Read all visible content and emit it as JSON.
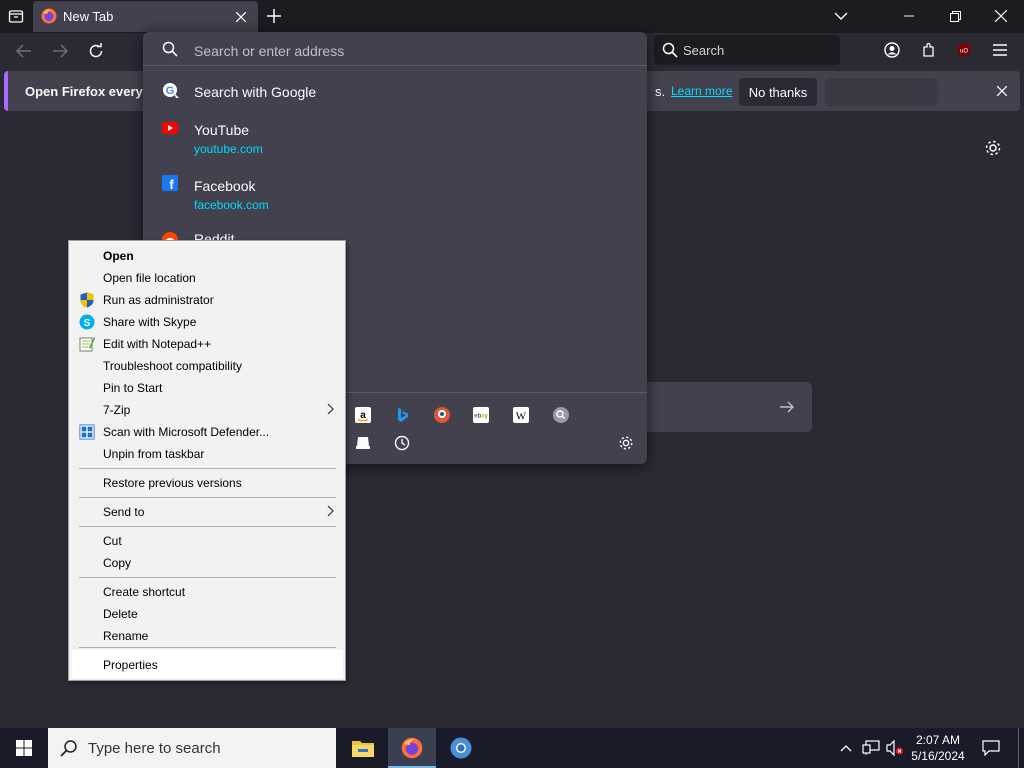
{
  "browser": {
    "tab_title": "New Tab",
    "url_placeholder": "Search or enter address",
    "search_placeholder": "Search"
  },
  "notification": {
    "text": "Open Firefox every ti",
    "tail": "s.",
    "learn_more": "Learn more",
    "no_thanks": "No thanks"
  },
  "suggestions": [
    {
      "title": "Search with Google",
      "url": ""
    },
    {
      "title": "YouTube",
      "url": "youtube.com"
    },
    {
      "title": "Facebook",
      "url": "facebook.com"
    },
    {
      "title": "Reddit",
      "url": ""
    }
  ],
  "context_menu": {
    "items": [
      {
        "label": "Open",
        "bold": true
      },
      {
        "label": "Open file location"
      },
      {
        "label": "Run as administrator",
        "icon": "uac-shield-icon"
      },
      {
        "label": "Share with Skype",
        "icon": "skype-icon"
      },
      {
        "label": "Edit with Notepad++",
        "icon": "notepadpp-icon"
      },
      {
        "label": "Troubleshoot compatibility"
      },
      {
        "label": "Pin to Start"
      },
      {
        "label": "7-Zip",
        "submenu": true
      },
      {
        "label": "Scan with Microsoft Defender...",
        "icon": "defender-icon"
      },
      {
        "label": "Unpin from taskbar"
      },
      {
        "label": "Restore previous versions"
      },
      {
        "label": "Send to",
        "submenu": true
      },
      {
        "label": "Cut"
      },
      {
        "label": "Copy"
      },
      {
        "label": "Create shortcut"
      },
      {
        "label": "Delete"
      },
      {
        "label": "Rename"
      },
      {
        "label": "Properties"
      }
    ]
  },
  "taskbar": {
    "search_placeholder": "Type here to search",
    "time": "2:07 AM",
    "date": "5/16/2024"
  },
  "colors": {
    "accent": "#00ddff",
    "notification_accent": "#a66bff",
    "taskbar": "#191c28"
  }
}
